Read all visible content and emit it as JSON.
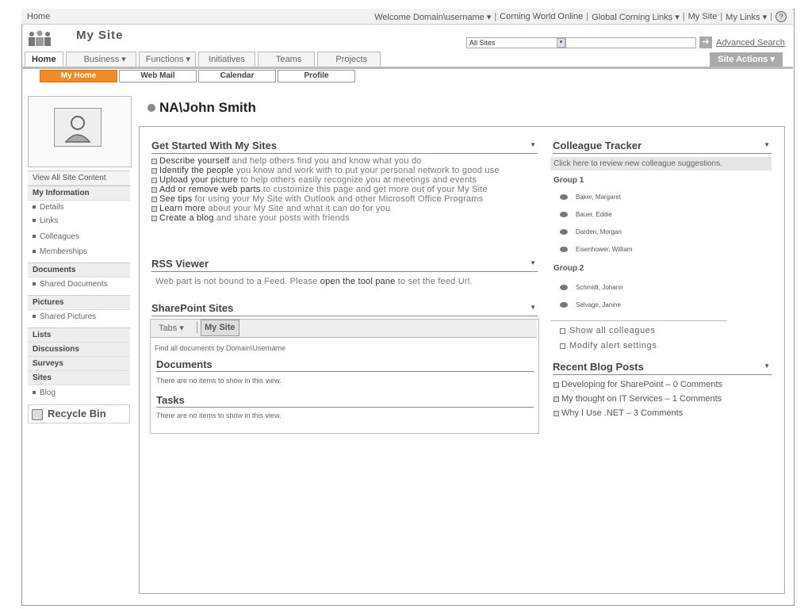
{
  "topbar": {
    "home": "Home",
    "welcome": "Welcome Domain\\username ▾",
    "links": [
      "Corning World Online",
      "Global Corning Links ▾",
      "My Site",
      "My Links ▾"
    ]
  },
  "header": {
    "site_title": "My Site",
    "scope": "All Sites",
    "advanced_search": "Advanced Search"
  },
  "tabs": [
    "Home",
    "Business ▾",
    "Functions ▾",
    "Initiatives",
    "Teams",
    "Projects"
  ],
  "site_actions": "Site Actions ▾",
  "subtabs": [
    "My Home",
    "Web Mail",
    "Calendar",
    "Profile"
  ],
  "leftnav": {
    "view_all": "View All Site Content",
    "my_information": "My Information",
    "info_items": [
      "Details",
      "Links",
      "Colleagues",
      "Memberships"
    ],
    "documents": "Documents",
    "doc_items": [
      "Shared Documents"
    ],
    "pictures": "Pictures",
    "pic_items": [
      "Shared Pictures"
    ],
    "lists": "Lists",
    "discussions": "Discussions",
    "surveys": "Surveys",
    "sites": "Sites",
    "site_items": [
      "Blog"
    ],
    "recycle_bin": "Recycle Bin"
  },
  "user": {
    "name": "NA\\John Smith"
  },
  "get_started": {
    "title": "Get Started With My Sites",
    "items": [
      {
        "link": "Describe yourself",
        "rest": " and help others find you and know what you do"
      },
      {
        "link": "Identify the people",
        "rest": " you know and work with to put your personal network to good use"
      },
      {
        "link": "Upload your picture",
        "rest": " to help others easily recognize you at meetings and events"
      },
      {
        "link": "Add or remove web parts",
        "rest": " to customize this page and get more out of your My Site"
      },
      {
        "link": "See tips",
        "rest": " for using your My Site with Outlook and other Microsoft Office Programs"
      },
      {
        "link": "Learn more",
        "rest": " about your My Site and what it can do for you"
      },
      {
        "link": "Create a blog",
        "rest": " and share your posts with friends"
      }
    ]
  },
  "rss": {
    "title": "RSS Viewer",
    "text_before": "Web part is not bound to a Feed. Please ",
    "link": "open the tool pane",
    "text_after": " to set the feed Url."
  },
  "sharepoint_sites": {
    "title": "SharePoint Sites",
    "tab1": "Tabs ▾",
    "tab2": "My Site",
    "find_text": "Find all documents by Domain\\Username",
    "documents_title": "Documents",
    "documents_empty": "There are no items to show in this view.",
    "tasks_title": "Tasks",
    "tasks_empty": "There are no items to show in this view."
  },
  "colleague_tracker": {
    "title": "Colleague Tracker",
    "suggestion": "Click here to review new colleague suggestions.",
    "group1": "Group 1",
    "group1_members": [
      "Baker, Margaret",
      "Bauer, Eddie",
      "Darden, Morgan",
      "Eisenhower, William"
    ],
    "group2": "Group 2",
    "group2_members": [
      "Schmidt, Johann",
      "Selvage, Janine"
    ],
    "show_all": "Show all colleagues",
    "modify": "Modify alert settings"
  },
  "blog_posts": {
    "title": "Recent Blog Posts",
    "items": [
      "Developing for SharePoint – 0 Comments",
      "My thought on IT Services – 1 Comments",
      "Why I Use .NET – 3 Comments"
    ]
  }
}
